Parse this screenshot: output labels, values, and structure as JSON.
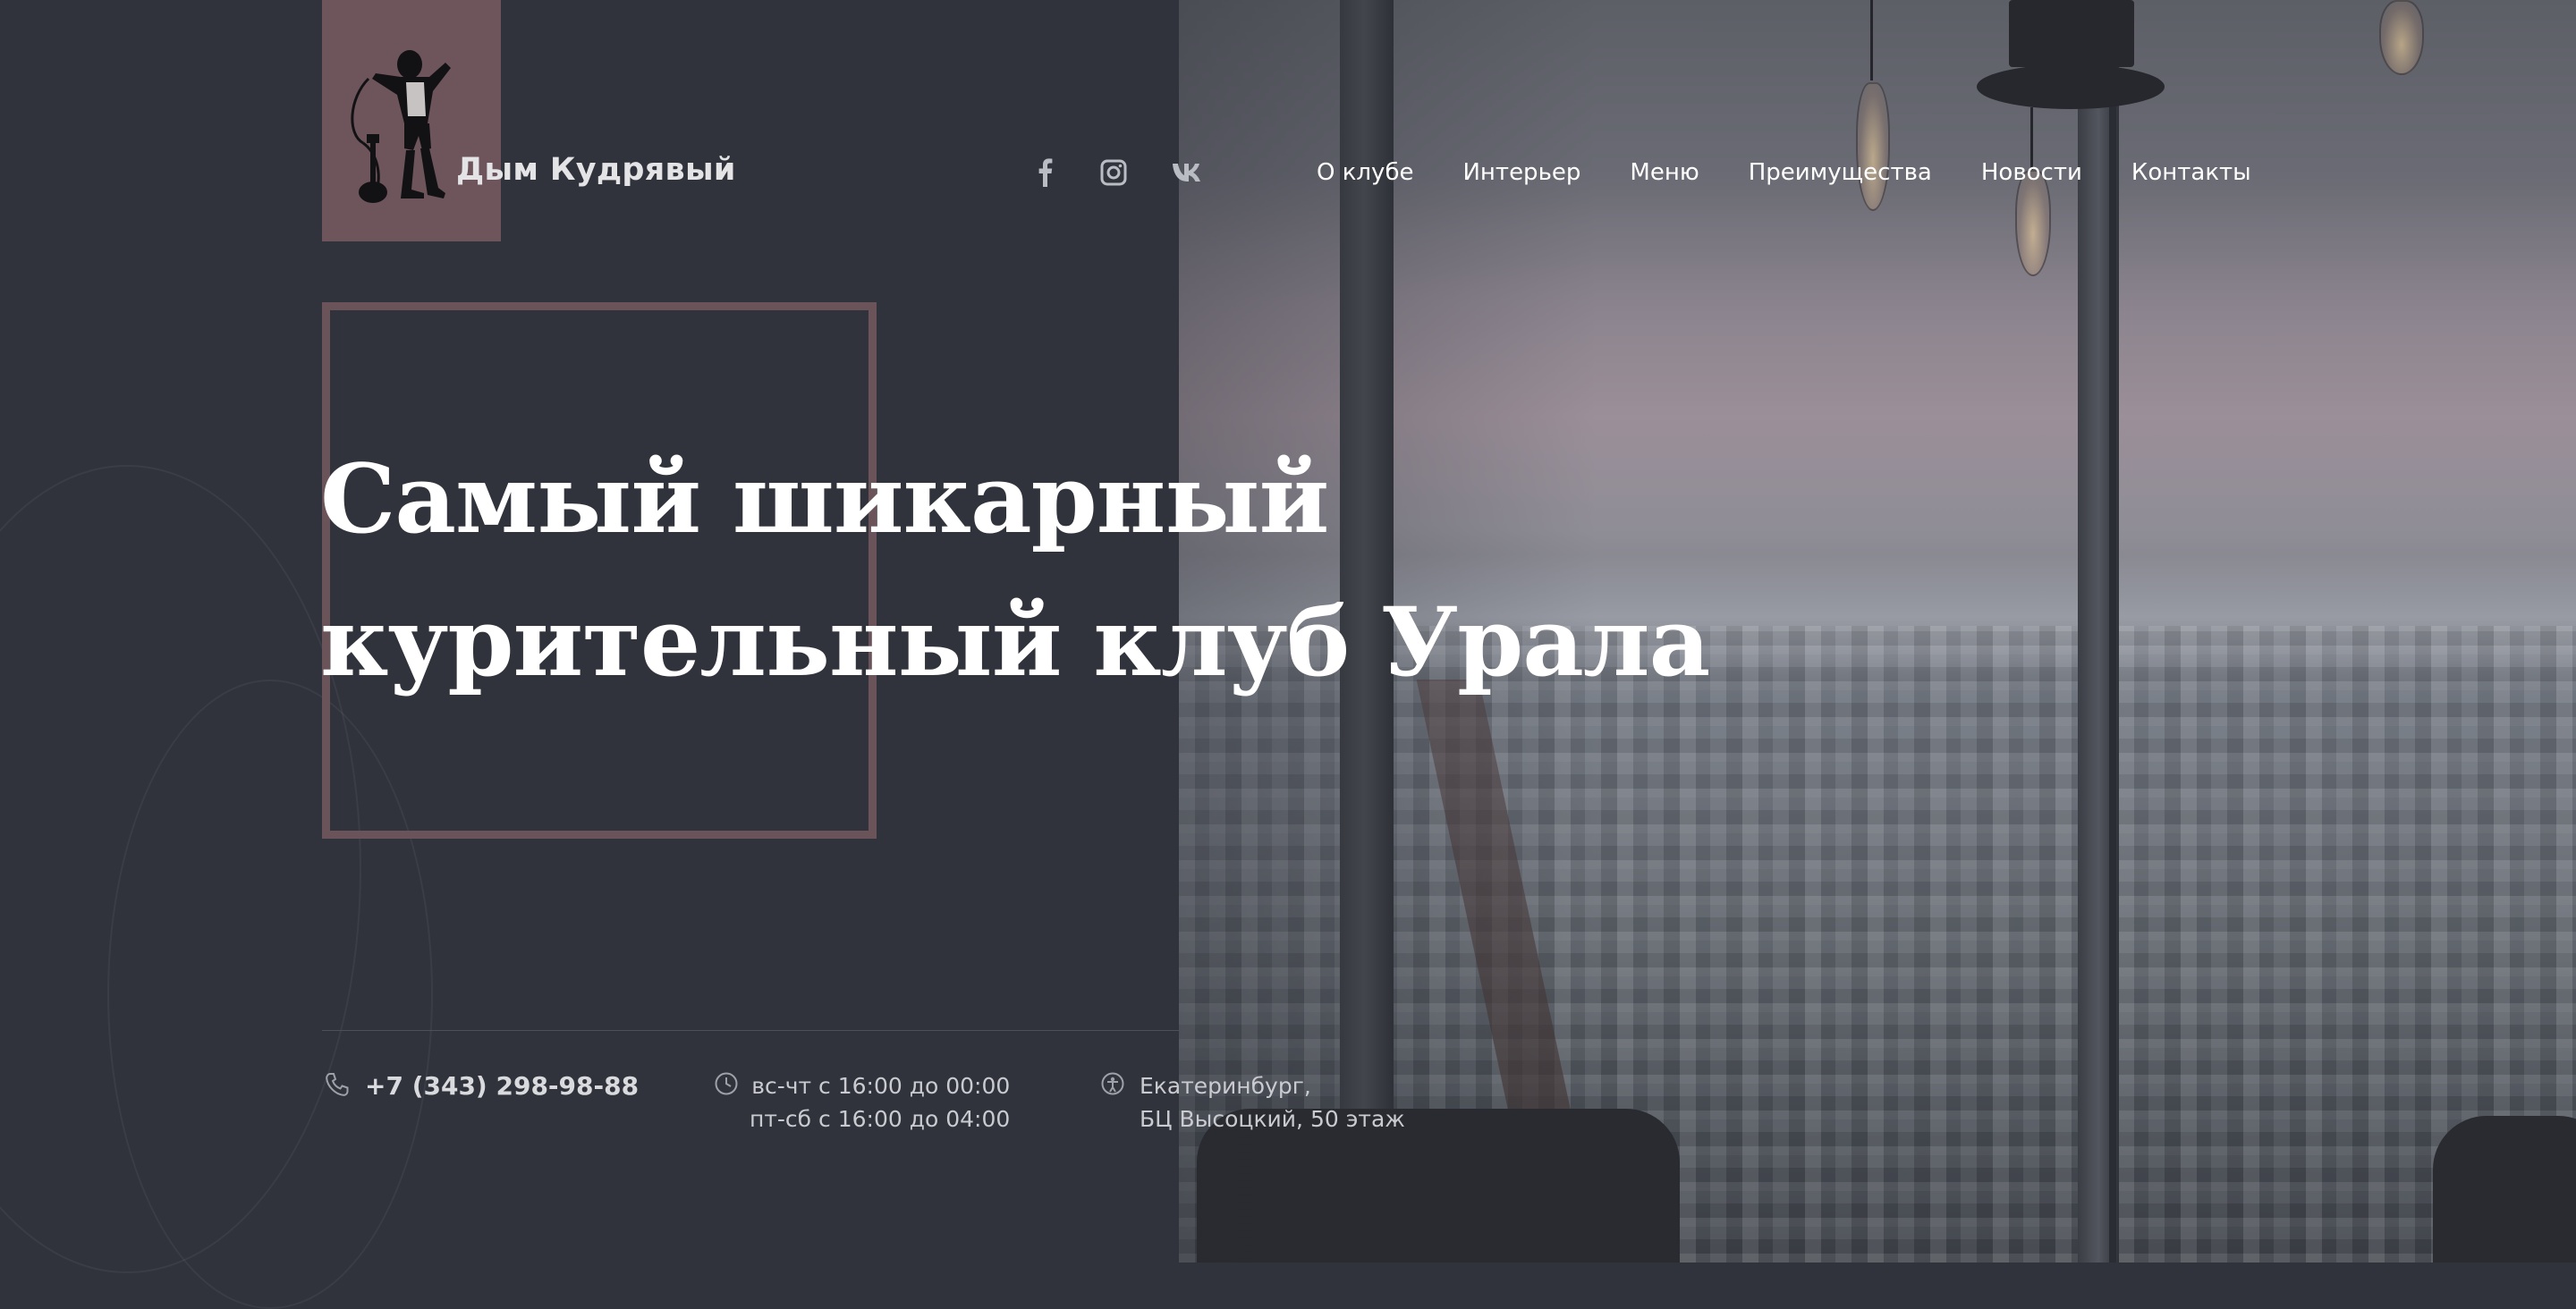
{
  "brand": {
    "name": "Дым Кудрявый",
    "accent_color": "#6e555c",
    "background_color": "#30333b"
  },
  "social": [
    {
      "name": "facebook",
      "icon": "facebook-icon"
    },
    {
      "name": "instagram",
      "icon": "instagram-icon"
    },
    {
      "name": "vk",
      "icon": "vk-icon"
    }
  ],
  "nav": {
    "items": [
      "О клубе",
      "Интерьер",
      "Меню",
      "Преимущества",
      "Новости",
      "Контакты"
    ]
  },
  "hero": {
    "title_line1": "Самый шикарный",
    "title_line2": "курительный клуб Урала"
  },
  "contacts": {
    "phone": "+7 (343) 298-98-88",
    "phone_icon": "phone-icon",
    "hours_line1": "вс-чт с 16:00 до 00:00",
    "hours_line2": "пт-сб с 16:00 до 04:00",
    "hours_icon": "clock-icon",
    "address_line1": "Екатеринбург,",
    "address_line2": "БЦ Высоцкий, 50 этаж",
    "address_icon": "location-icon"
  }
}
